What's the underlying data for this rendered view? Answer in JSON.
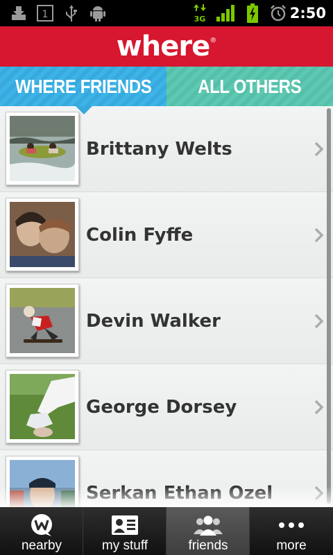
{
  "status_bar": {
    "time": "2:50",
    "network_label": "3G",
    "notification_badge": "1",
    "icons": [
      "download-icon",
      "notification-icon",
      "usb-icon",
      "android-debug-icon",
      "network-3g-icon",
      "signal-icon",
      "battery-charging-icon",
      "alarm-icon"
    ]
  },
  "header": {
    "logo_text": "where",
    "logo_mark": "®"
  },
  "tabs": [
    {
      "label": "WHERE FRIENDS",
      "selected": true
    },
    {
      "label": "ALL OTHERS",
      "selected": false
    }
  ],
  "friends": [
    {
      "name": "Brittany Welts",
      "photo": "photo-tubing-icon"
    },
    {
      "name": "Colin Fyffe",
      "photo": "photo-two-people-icon"
    },
    {
      "name": "Devin Walker",
      "photo": "photo-skateboarder-icon"
    },
    {
      "name": "George Dorsey",
      "photo": "photo-grass-icon"
    },
    {
      "name": "Serkan Ethan Ozel",
      "photo": "photo-portrait-icon"
    }
  ],
  "bottom_nav": [
    {
      "label": "nearby",
      "icon": "where-logo-icon",
      "active": false
    },
    {
      "label": "my stuff",
      "icon": "profile-card-icon",
      "active": false
    },
    {
      "label": "friends",
      "icon": "friends-icon",
      "active": true
    },
    {
      "label": "more",
      "icon": "more-dots-icon",
      "active": false
    }
  ],
  "colors": {
    "header_red": "#d6172f",
    "tab_blue": "#3db4e8",
    "tab_teal": "#5ec9b3",
    "status_green": "#7cc800"
  }
}
